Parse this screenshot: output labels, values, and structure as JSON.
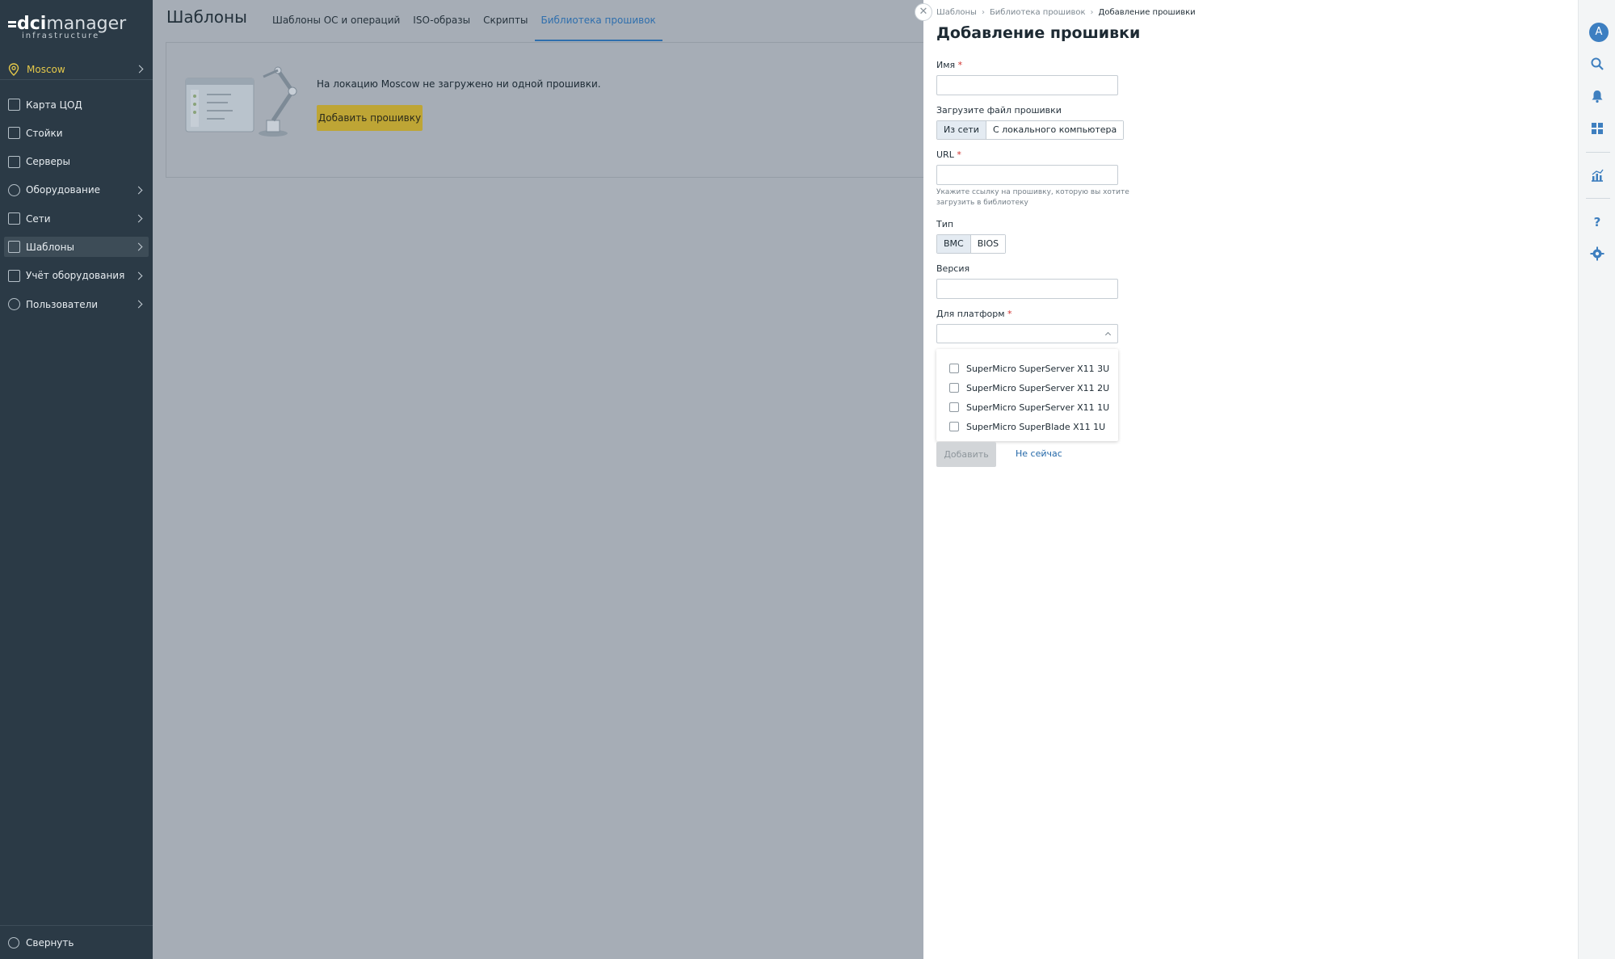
{
  "app": {
    "logo_prefix": "dci",
    "logo_suffix": "manager",
    "logo_sub": "infrastructure"
  },
  "sidebar": {
    "location": "Moscow",
    "items": [
      {
        "label": "Карта ЦОД",
        "icon": "datacenter-map-icon",
        "has_arrow": false
      },
      {
        "label": "Стойки",
        "icon": "rack-icon",
        "has_arrow": false
      },
      {
        "label": "Серверы",
        "icon": "server-icon",
        "has_arrow": false
      },
      {
        "label": "Оборудование",
        "icon": "equipment-icon",
        "has_arrow": true
      },
      {
        "label": "Сети",
        "icon": "network-icon",
        "has_arrow": true
      },
      {
        "label": "Шаблоны",
        "icon": "templates-icon",
        "has_arrow": true,
        "active": true
      },
      {
        "label": "Учёт оборудования",
        "icon": "inventory-icon",
        "has_arrow": true
      },
      {
        "label": "Пользователи",
        "icon": "users-icon",
        "has_arrow": true
      }
    ],
    "collapse_label": "Свернуть"
  },
  "main": {
    "title": "Шаблоны",
    "tabs": [
      {
        "label": "Шаблоны ОС и операций",
        "active": false
      },
      {
        "label": "ISO-образы",
        "active": false
      },
      {
        "label": "Скрипты",
        "active": false
      },
      {
        "label": "Библиотека прошивок",
        "active": true
      }
    ],
    "empty_message": "На локацию Moscow не загружено ни одной прошивки.",
    "add_button": "Добавить прошивку"
  },
  "drawer": {
    "breadcrumbs": [
      "Шаблоны",
      "Библиотека прошивок",
      "Добавление прошивки"
    ],
    "title": "Добавление прошивки",
    "name_label": "Имя",
    "upload_label": "Загрузите файл прошивки",
    "upload_options": [
      "Из сети",
      "С локального компьютера"
    ],
    "upload_selected": "Из сети",
    "url_label": "URL",
    "url_hint": "Укажите ссылку на прошивку, которую вы хотите загрузить в библиотеку",
    "type_label": "Тип",
    "type_options": [
      "BMC",
      "BIOS"
    ],
    "type_selected": "BMC",
    "version_label": "Версия",
    "platform_label": "Для платформ",
    "platform_options": [
      "SuperMicro SuperServer X11 3U",
      "SuperMicro SuperServer X11 2U",
      "SuperMicro SuperServer X11 1U",
      "SuperMicro SuperBlade X11 1U"
    ],
    "submit_label": "Добавить",
    "cancel_label": "Не сейчас"
  },
  "rail": {
    "avatar_letter": "A"
  },
  "colors": {
    "sidebar_bg": "#2b3a46",
    "overlay_bg": "#a6adb6",
    "accent_link": "#2f6fad",
    "primary_button": "#bea535",
    "location_text": "#e4c84a",
    "avatar": "#3d7fc1"
  }
}
